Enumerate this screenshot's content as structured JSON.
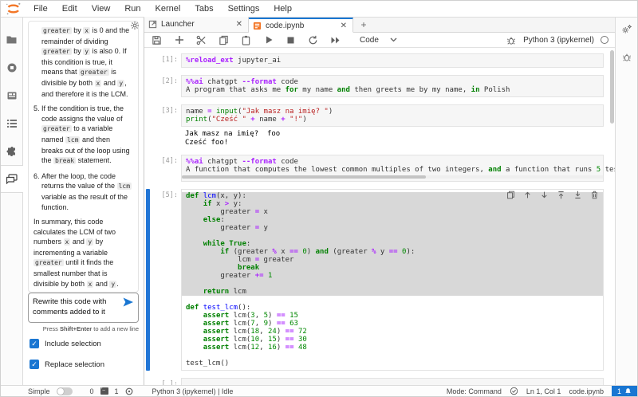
{
  "menu": {
    "items": [
      "File",
      "Edit",
      "View",
      "Run",
      "Kernel",
      "Tabs",
      "Settings",
      "Help"
    ]
  },
  "left_sidebar": {
    "icons": [
      "file-browser",
      "running-kernels",
      "property-inspector",
      "table-of-contents",
      "extensions",
      "chat"
    ]
  },
  "chat_panel": {
    "blocks": [
      {
        "type": "cont",
        "runs": [
          {
            "t": "greater",
            "code": true
          },
          {
            "t": " by "
          },
          {
            "t": "x",
            "code": true
          },
          {
            "t": " is 0 and the remainder of dividing "
          },
          {
            "t": "greater",
            "code": true
          },
          {
            "t": " by "
          },
          {
            "t": "y",
            "code": true
          },
          {
            "t": " is also 0. If this condition is true, it means that "
          },
          {
            "t": "greater",
            "code": true
          },
          {
            "t": " is divisible by both "
          },
          {
            "t": "x",
            "code": true
          },
          {
            "t": " and "
          },
          {
            "t": "y",
            "code": true
          },
          {
            "t": ", and therefore it is the LCM."
          }
        ]
      },
      {
        "type": "li",
        "num": "5.",
        "runs": [
          {
            "t": "If the condition is true, the code assigns the value of "
          },
          {
            "t": "greater",
            "code": true
          },
          {
            "t": " to a variable named "
          },
          {
            "t": "lcm",
            "code": true
          },
          {
            "t": " and then breaks out of the loop using the "
          },
          {
            "t": "break",
            "code": true
          },
          {
            "t": " statement."
          }
        ]
      },
      {
        "type": "li",
        "num": "6.",
        "runs": [
          {
            "t": "After the loop, the code returns the value of the "
          },
          {
            "t": "lcm",
            "code": true
          },
          {
            "t": " variable as the result of the function."
          }
        ]
      },
      {
        "type": "p",
        "runs": [
          {
            "t": "In summary, this code calculates the LCM of two numbers "
          },
          {
            "t": "x",
            "code": true
          },
          {
            "t": " and "
          },
          {
            "t": "y",
            "code": true
          },
          {
            "t": " by incrementing a variable "
          },
          {
            "t": "greater",
            "code": true
          },
          {
            "t": " until it finds the smallest number that is divisible by both "
          },
          {
            "t": "x",
            "code": true
          },
          {
            "t": " and "
          },
          {
            "t": "y",
            "code": true
          },
          {
            "t": "."
          }
        ]
      }
    ],
    "input_value": "Rewrite this code with comments added to it",
    "hint": [
      {
        "t": "Press "
      },
      {
        "t": "Shift+Enter",
        "b": true
      },
      {
        "t": " to add a new line"
      }
    ],
    "checkboxes": [
      {
        "label": "Include selection",
        "checked": true
      },
      {
        "label": "Replace selection",
        "checked": true
      }
    ]
  },
  "tabs": {
    "launcher": "Launcher",
    "notebook": "code.ipynb",
    "close_glyph": "✕"
  },
  "toolbar": {
    "mode_label": "Code",
    "kernel": "Python 3 (ipykernel)"
  },
  "notebook": {
    "cells": [
      {
        "prompt": "[1]:",
        "lines": [
          [
            {
              "s": "%reload_ext",
              "c": "mg"
            },
            {
              "s": " jupyter_ai"
            }
          ]
        ]
      },
      {
        "prompt": "[2]:",
        "lines": [
          [
            {
              "s": "%%ai",
              "c": "mg"
            },
            {
              "s": " chatgpt "
            },
            {
              "s": "--format",
              "c": "mg"
            },
            {
              "s": " code"
            }
          ],
          [
            {
              "s": "A program that asks me "
            },
            {
              "s": "for",
              "c": "kw"
            },
            {
              "s": " my name "
            },
            {
              "s": "and",
              "c": "kw"
            },
            {
              "s": " then greets me by my name, "
            },
            {
              "s": "in",
              "c": "kw"
            },
            {
              "s": " Polish"
            }
          ]
        ]
      },
      {
        "prompt": "[3]:",
        "lines": [
          [
            {
              "s": "name "
            },
            {
              "s": "=",
              "c": "op"
            },
            {
              "s": " "
            },
            {
              "s": "input",
              "c": "bi"
            },
            {
              "s": "("
            },
            {
              "s": "\"Jak masz na imię? \"",
              "c": "st"
            },
            {
              "s": ")"
            }
          ],
          [
            {
              "s": "print",
              "c": "bi"
            },
            {
              "s": "("
            },
            {
              "s": "\"Cześć \"",
              "c": "st"
            },
            {
              "s": " "
            },
            {
              "s": "+",
              "c": "op"
            },
            {
              "s": " name "
            },
            {
              "s": "+",
              "c": "op"
            },
            {
              "s": " "
            },
            {
              "s": "\"!\"",
              "c": "st"
            },
            {
              "s": ")"
            }
          ]
        ],
        "outputs": [
          "Jak masz na imię?  foo",
          "Cześć foo!"
        ]
      },
      {
        "prompt": "[4]:",
        "hscroll": true,
        "lines": [
          [
            {
              "s": "%%ai",
              "c": "mg"
            },
            {
              "s": " chatgpt "
            },
            {
              "s": "--format",
              "c": "mg"
            },
            {
              "s": " code"
            }
          ],
          [
            {
              "s": "A function that computes the lowest common multiples of two integers, "
            },
            {
              "s": "and",
              "c": "kw"
            },
            {
              "s": " a function that runs "
            },
            {
              "s": "5",
              "c": "nu"
            },
            {
              "s": " test cases of the lowest"
            }
          ]
        ]
      },
      {
        "prompt": "[5]:",
        "selected": true,
        "sel_count": 13,
        "toolbar": [
          "duplicate",
          "move-up",
          "move-down",
          "insert-above",
          "insert-below",
          "delete"
        ],
        "lines": [
          [
            {
              "s": "def",
              "c": "kw"
            },
            {
              "s": " "
            },
            {
              "s": "lcm",
              "c": "fn"
            },
            {
              "s": "(x, y):"
            }
          ],
          [
            {
              "s": "    "
            },
            {
              "s": "if",
              "c": "kw"
            },
            {
              "s": " x "
            },
            {
              "s": ">",
              "c": "op"
            },
            {
              "s": " y:"
            }
          ],
          [
            {
              "s": "        greater "
            },
            {
              "s": "=",
              "c": "op"
            },
            {
              "s": " x"
            }
          ],
          [
            {
              "s": "    "
            },
            {
              "s": "else",
              "c": "kw"
            },
            {
              "s": ":"
            }
          ],
          [
            {
              "s": "        greater "
            },
            {
              "s": "=",
              "c": "op"
            },
            {
              "s": " y"
            }
          ],
          [],
          [
            {
              "s": "    "
            },
            {
              "s": "while",
              "c": "kw"
            },
            {
              "s": " "
            },
            {
              "s": "True",
              "c": "kw"
            },
            {
              "s": ":"
            }
          ],
          [
            {
              "s": "        "
            },
            {
              "s": "if",
              "c": "kw"
            },
            {
              "s": " (greater "
            },
            {
              "s": "%",
              "c": "op"
            },
            {
              "s": " x "
            },
            {
              "s": "==",
              "c": "op"
            },
            {
              "s": " "
            },
            {
              "s": "0",
              "c": "nu"
            },
            {
              "s": ") "
            },
            {
              "s": "and",
              "c": "kw"
            },
            {
              "s": " (greater "
            },
            {
              "s": "%",
              "c": "op"
            },
            {
              "s": " y "
            },
            {
              "s": "==",
              "c": "op"
            },
            {
              "s": " "
            },
            {
              "s": "0",
              "c": "nu"
            },
            {
              "s": "):"
            }
          ],
          [
            {
              "s": "            lcm "
            },
            {
              "s": "=",
              "c": "op"
            },
            {
              "s": " greater"
            }
          ],
          [
            {
              "s": "            "
            },
            {
              "s": "break",
              "c": "kw"
            }
          ],
          [
            {
              "s": "        greater "
            },
            {
              "s": "+=",
              "c": "op"
            },
            {
              "s": " "
            },
            {
              "s": "1",
              "c": "nu"
            }
          ],
          [],
          [
            {
              "s": "    "
            },
            {
              "s": "return",
              "c": "kw"
            },
            {
              "s": " lcm"
            }
          ],
          [],
          [
            {
              "s": "def",
              "c": "kw"
            },
            {
              "s": " "
            },
            {
              "s": "test_lcm",
              "c": "fn"
            },
            {
              "s": "():"
            }
          ],
          [
            {
              "s": "    "
            },
            {
              "s": "assert",
              "c": "kw"
            },
            {
              "s": " lcm("
            },
            {
              "s": "3",
              "c": "nu"
            },
            {
              "s": ", "
            },
            {
              "s": "5",
              "c": "nu"
            },
            {
              "s": ") "
            },
            {
              "s": "==",
              "c": "op"
            },
            {
              "s": " "
            },
            {
              "s": "15",
              "c": "nu"
            }
          ],
          [
            {
              "s": "    "
            },
            {
              "s": "assert",
              "c": "kw"
            },
            {
              "s": " lcm("
            },
            {
              "s": "7",
              "c": "nu"
            },
            {
              "s": ", "
            },
            {
              "s": "9",
              "c": "nu"
            },
            {
              "s": ") "
            },
            {
              "s": "==",
              "c": "op"
            },
            {
              "s": " "
            },
            {
              "s": "63",
              "c": "nu"
            }
          ],
          [
            {
              "s": "    "
            },
            {
              "s": "assert",
              "c": "kw"
            },
            {
              "s": " lcm("
            },
            {
              "s": "18",
              "c": "nu"
            },
            {
              "s": ", "
            },
            {
              "s": "24",
              "c": "nu"
            },
            {
              "s": ") "
            },
            {
              "s": "==",
              "c": "op"
            },
            {
              "s": " "
            },
            {
              "s": "72",
              "c": "nu"
            }
          ],
          [
            {
              "s": "    "
            },
            {
              "s": "assert",
              "c": "kw"
            },
            {
              "s": " lcm("
            },
            {
              "s": "10",
              "c": "nu"
            },
            {
              "s": ", "
            },
            {
              "s": "15",
              "c": "nu"
            },
            {
              "s": ") "
            },
            {
              "s": "==",
              "c": "op"
            },
            {
              "s": " "
            },
            {
              "s": "30",
              "c": "nu"
            }
          ],
          [
            {
              "s": "    "
            },
            {
              "s": "assert",
              "c": "kw"
            },
            {
              "s": " lcm("
            },
            {
              "s": "12",
              "c": "nu"
            },
            {
              "s": ", "
            },
            {
              "s": "16",
              "c": "nu"
            },
            {
              "s": ") "
            },
            {
              "s": "==",
              "c": "op"
            },
            {
              "s": " "
            },
            {
              "s": "48",
              "c": "nu"
            }
          ],
          [],
          [
            {
              "s": "test_lcm()"
            }
          ]
        ]
      },
      {
        "prompt": "[ ]:",
        "lines": [
          []
        ]
      }
    ]
  },
  "right_sidebar": {
    "icons": [
      "property-inspector-settings",
      "debugger"
    ]
  },
  "statusbar": {
    "simple_label": "Simple",
    "terminals": "0",
    "kernels": "1",
    "kernel_status": "Python 3 (ipykernel) | Idle",
    "mode": "Mode: Command",
    "position": "Ln 1, Col 1",
    "filename": "code.ipynb",
    "notifications": "1"
  },
  "colors": {
    "accent": "#1976d2",
    "jupyter_orange": "#f37626",
    "selection": "#d8d8d8"
  }
}
